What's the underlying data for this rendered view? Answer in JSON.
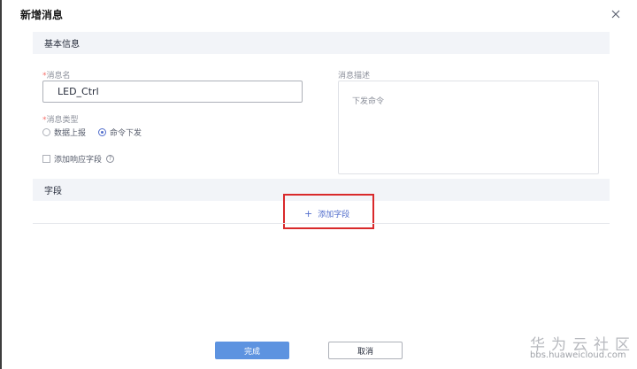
{
  "dialog": {
    "title": "新增消息",
    "close_glyph": "×"
  },
  "sections": {
    "basic_info": "基本信息",
    "fields": "字段"
  },
  "form": {
    "message_name": {
      "required_mark": "*",
      "label": "消息名",
      "value": "LED_Ctrl"
    },
    "message_type": {
      "required_mark": "*",
      "label": "消息类型",
      "options": [
        "数据上报",
        "命令下发"
      ],
      "selected": "命令下发"
    },
    "add_response_field": {
      "label": "添加响应字段",
      "checked": false
    },
    "description": {
      "label": "消息描述",
      "value": "下发命令"
    }
  },
  "fields_section": {
    "add_field_label": "添加字段",
    "add_icon": "plus-icon"
  },
  "footer": {
    "confirm_label": "完成",
    "cancel_label": "取消"
  },
  "watermark": {
    "brand": "华为云社区",
    "url": "bbs.huaweicloud.com"
  },
  "colors": {
    "primary": "#5d93e0",
    "link": "#526ecc",
    "highlight_box": "#d9292b",
    "section_bg": "#f2f4f8"
  }
}
